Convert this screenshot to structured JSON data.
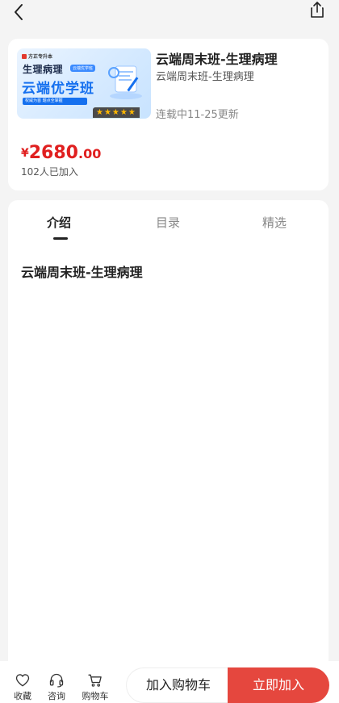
{
  "course": {
    "cover": {
      "brand": "方正专升本",
      "line1": "生理病理",
      "tag": "云端优学班",
      "line2": "云端优学班",
      "strip": "权威为首  题点全掌握",
      "stars": "★★★★★"
    },
    "title": "云端周末班-生理病理",
    "subtitle": "云端周末班-生理病理",
    "update_status": "连载中11-25更新",
    "price_symbol": "¥",
    "price_integer": "2680",
    "price_decimal": ".00",
    "joined_count": "102人已加入"
  },
  "tabs": [
    {
      "label": "介绍",
      "active": true
    },
    {
      "label": "目录",
      "active": false
    },
    {
      "label": "精选",
      "active": false
    }
  ],
  "intro": {
    "heading": "云端周末班-生理病理"
  },
  "bottom_bar": {
    "favorite_label": "收藏",
    "consult_label": "咨询",
    "cart_label": "购物车",
    "add_to_cart_label": "加入购物车",
    "join_now_label": "立即加入"
  },
  "colors": {
    "accent_red": "#e5473e",
    "price_red": "#e02020",
    "cover_blue": "#1570ef"
  }
}
